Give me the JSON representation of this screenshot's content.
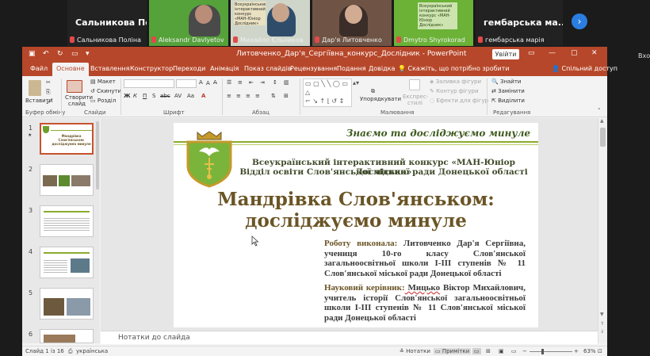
{
  "meeting": {
    "participants": [
      {
        "tile_name": "Сальникова По...",
        "label": "Сальникова Поліна"
      },
      {
        "tile_name": "",
        "label": "Aleksandr Davlyetov"
      },
      {
        "tile_name": "",
        "label": "Михайло Єльников"
      },
      {
        "tile_name": "",
        "label": "Дар'я Литовченко"
      },
      {
        "tile_name": "",
        "label": "Dmytro Shyrokorad"
      },
      {
        "tile_name": "гембарська ма...",
        "label": "гембарська марія"
      }
    ],
    "poster_text": "Всеукраїнський інтерактивний конкурс «МАН-Юніор Дослідник»",
    "next_icon": "chevron-right-icon",
    "side_label": "Вхо"
  },
  "app": {
    "title": "Литовченко_Дар'я_Сергіївна_конкурс_Дослідник  -  PowerPoint",
    "enter_button": "Увійти",
    "share": "Спільний доступ",
    "tabs": [
      "Файл",
      "Основне",
      "Вставлення",
      "Конструктор",
      "Переходи",
      "Анімація",
      "Показ слайдів",
      "Рецензування",
      "Подання",
      "Довідка"
    ],
    "active_tab": "Основне",
    "tell_me": "Скажіть, що потрібно зробити",
    "accent": "#b7472a"
  },
  "ribbon": {
    "paste": "Вставити",
    "new_slide_1": "Створити",
    "new_slide_2": "слайд",
    "layout": "Макет",
    "reset": "Скинути",
    "section": "Розділ",
    "shapes_label": "Фігури",
    "arrange": "Упорядкувати",
    "quick_styles_1": "Експрес-",
    "quick_styles_2": "стилі",
    "fill": "Заливка фігури",
    "outline": "Контур фігури",
    "effects": "Ефекти для фігур",
    "find": "Знайти",
    "replace": "Замінити",
    "select": "Виділити",
    "group_clipboard": "Буфер обміну",
    "group_slides": "Слайди",
    "group_font": "Шрифт",
    "group_paragraph": "Абзац",
    "group_drawing": "Малювання",
    "group_editing": "Редагування",
    "font_buttons": [
      "Ж",
      "К",
      "П",
      "S",
      "abc",
      "AV",
      "Aa",
      "A"
    ]
  },
  "thumbnails": [
    {
      "num": "1",
      "star": "★",
      "caption": "Мандрівка Слов'янськом: досліджуємо минуле"
    },
    {
      "num": "2"
    },
    {
      "num": "3"
    },
    {
      "num": "4"
    },
    {
      "num": "5"
    },
    {
      "num": "6"
    }
  ],
  "slide": {
    "header": "Знаємо та досліджуємо минуле",
    "org_line1": "Всеукраїнський інтерактивний конкурс «МАН-Юніор Дослідник»",
    "org_line2": "Відділ освіти Слов'янської міської ради Донецької області",
    "title_line1": "Мандрівка Слов'янськом:",
    "title_line2": "досліджуємо минуле",
    "author_label": "Роботу виконала:",
    "author_text": " Литовченко Дар'я Сергіївна, учениця 10-го класу Слов'янської загальноосвітньої школи І-ІІІ ступенів № 11 Слов'янської міської ради Донецької області",
    "advisor_label": "Науковий керівник:",
    "advisor_name": " Мицько",
    "advisor_text": " Віктор Михайлович, учитель історії Слов'янської загальноосвітньої школи І-ІІІ ступенів № 11 Слов'янської міської ради Донецької області",
    "header_color": "#3f5a1f",
    "title_color": "#6b5526",
    "stripe_color": "#8cab2e"
  },
  "notes_placeholder": "Нотатки до слайда",
  "status": {
    "slide_info": "Слайд 1 із 16",
    "language": "українська",
    "notes": "Нотатки",
    "comments": "Примітки",
    "zoom": "63%"
  }
}
